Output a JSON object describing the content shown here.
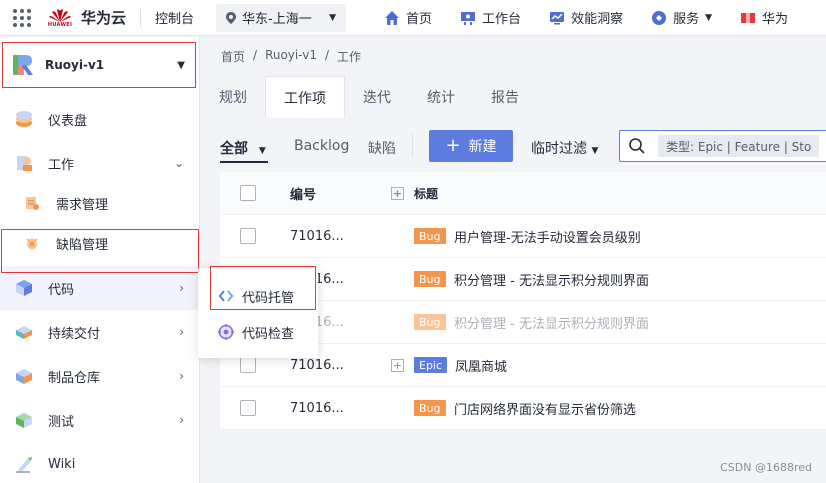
{
  "header": {
    "logo_text": "HUAWEI",
    "brand": "华为云",
    "console": "控制台",
    "region": "华东-上海一",
    "nav": [
      {
        "label": "首页",
        "icon": "home-icon"
      },
      {
        "label": "工作台",
        "icon": "workbench-icon"
      },
      {
        "label": "效能洞察",
        "icon": "insight-icon"
      },
      {
        "label": "服务",
        "icon": "service-icon"
      },
      {
        "label": "华为",
        "icon": "flag-icon"
      }
    ]
  },
  "sidebar": {
    "project": "Ruoyi-v1",
    "items": [
      {
        "label": "仪表盘"
      },
      {
        "label": "工作"
      },
      {
        "label": "需求管理"
      },
      {
        "label": "缺陷管理"
      },
      {
        "label": "代码"
      },
      {
        "label": "持续交付"
      },
      {
        "label": "制品仓库"
      },
      {
        "label": "测试"
      },
      {
        "label": "Wiki"
      }
    ]
  },
  "flyout": {
    "items": [
      {
        "label": "代码托管"
      },
      {
        "label": "代码检查"
      }
    ]
  },
  "breadcrumb": [
    "首页",
    "/",
    "Ruoyi-v1",
    "/",
    "工作"
  ],
  "tabs": [
    "规划",
    "工作项",
    "迭代",
    "统计",
    "报告"
  ],
  "toolbar": {
    "filter_all": "全部",
    "filter_backlog": "Backlog",
    "filter_defect": "缺陷",
    "new_label": "新建",
    "quick_filter": "临时过滤",
    "search_chip": "类型:   Epic   |   Feature   |   Sto"
  },
  "table": {
    "headers": {
      "num": "编号",
      "title": "标题"
    },
    "rows": [
      {
        "num": "71016...",
        "type": "Bug",
        "title": "用户管理-无法手动设置会员级别"
      },
      {
        "num": "71016...",
        "type": "Bug",
        "title": "积分管理 - 无法显示积分规则界面"
      },
      {
        "num": "71016...",
        "type": "Bug",
        "title": "积分管理 - 无法显示积分规则界面"
      },
      {
        "num": "71016...",
        "type": "Epic",
        "title": "凤凰商城"
      },
      {
        "num": "71016...",
        "type": "Bug",
        "title": "门店网络界面没有显示省份筛选"
      }
    ]
  },
  "watermark": "CSDN @1688red"
}
